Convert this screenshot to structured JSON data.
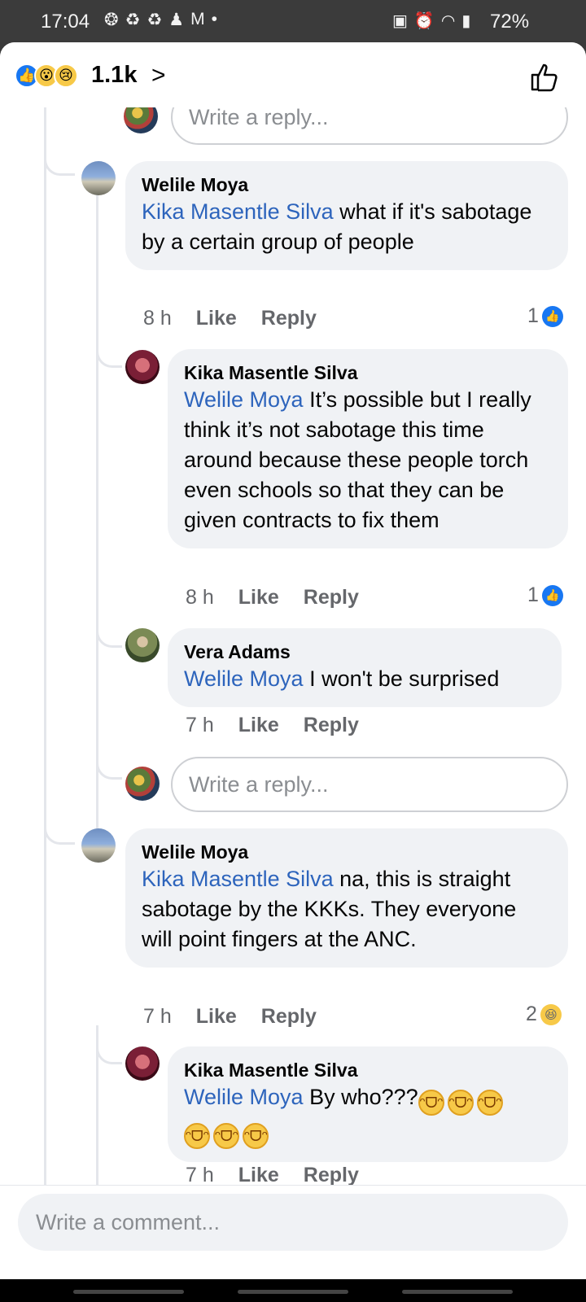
{
  "status_bar": {
    "time": "17:04",
    "battery": "72%"
  },
  "header": {
    "reaction_count": "1.1k",
    "reactions": [
      "like-icon",
      "wow-icon",
      "sad-icon"
    ]
  },
  "reply_placeholder": "Write a reply...",
  "comments": [
    {
      "author": "Welile Moya",
      "mention": "Kika Masentle Silva",
      "text": " what if it's sabotage by a certain group of people",
      "time": "8 h",
      "like_label": "Like",
      "reply_label": "Reply",
      "reaction_count": "1"
    },
    {
      "author": "Kika Masentle Silva",
      "mention": "Welile Moya",
      "text": " It’s possible but I really think it’s not sabotage this time around because these people torch even schools so that they can be given contracts to fix them",
      "time": "8 h",
      "like_label": "Like",
      "reply_label": "Reply",
      "reaction_count": "1"
    },
    {
      "author": "Vera Adams",
      "mention": "Welile Moya",
      "text": " I won't be surprised",
      "time": "7 h",
      "like_label": "Like",
      "reply_label": "Reply"
    },
    {
      "author": "Welile Moya",
      "mention": "Kika Masentle Silva",
      "text": " na, this is straight sabotage by the KKKs. They everyone will point fingers at the ANC.",
      "time": "7 h",
      "like_label": "Like",
      "reply_label": "Reply",
      "reaction_count": "2"
    },
    {
      "author": "Kika Masentle Silva",
      "mention": "Welile Moya",
      "text": " By who???",
      "time": "7 h",
      "like_label": "Like",
      "reply_label": "Reply"
    }
  ],
  "comment_placeholder": "Write a comment..."
}
